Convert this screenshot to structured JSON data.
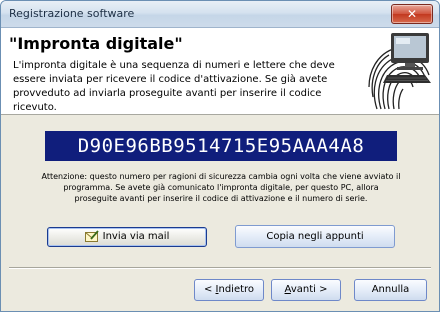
{
  "window": {
    "title": "Registrazione software",
    "close_glyph": "✕"
  },
  "header": {
    "heading": "\"Impronta digitale\"",
    "description": "L'impronta digitale è una sequenza di numeri e lettere che deve essere inviata per ricevere il codice d'attivazione. Se già avete provveduto ad inviarla proseguite avanti per inserire il codice ricevuto.",
    "illustration_icon": "computer-fingerprint-icon"
  },
  "fingerprint": {
    "code": "D90E96BB9514715E95AAA4A8"
  },
  "note": "Attenzione: questo numero per ragioni di sicurezza cambia ogni volta che viene avviato il programma. Se avete già comunicato l'impronta digitale, per questo PC, allora proseguite avanti per inserire il codice di attivazione e il numero di serie.",
  "actions": {
    "mail_label": "Invia via mail",
    "mail_icon": "mail-edit-icon",
    "copy_label": "Copia negli appunti"
  },
  "nav": {
    "back_label": "< Indietro",
    "back_accel": "I",
    "next_label": "Avanti >",
    "next_accel": "A",
    "cancel_label": "Annulla"
  },
  "colors": {
    "code_background": "#101e7c",
    "code_text": "#ffffff"
  }
}
